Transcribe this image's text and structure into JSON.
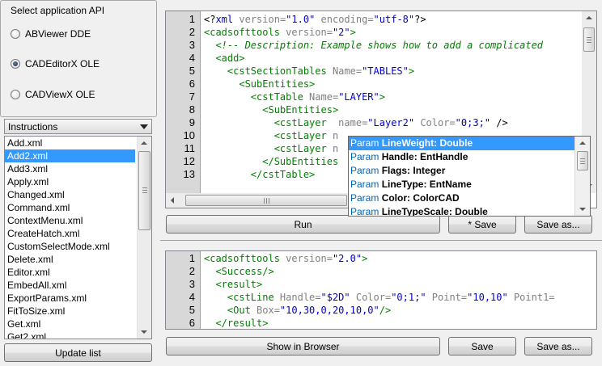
{
  "api_group": {
    "title": "Select application API",
    "options": [
      {
        "label": "ABViewer DDE",
        "checked": false
      },
      {
        "label": "CADEditorX OLE",
        "checked": true
      },
      {
        "label": "CADViewX OLE",
        "checked": false
      }
    ]
  },
  "instructions": {
    "selected": "Instructions",
    "files": [
      "Add.xml",
      "Add2.xml",
      "Add3.xml",
      "Apply.xml",
      "Changed.xml",
      "Command.xml",
      "ContextMenu.xml",
      "CreateHatch.xml",
      "CustomSelectMode.xml",
      "Delete.xml",
      "Editor.xml",
      "EmbedAll.xml",
      "ExportParams.xml",
      "FitToSize.xml",
      "Get.xml",
      "Get2.xml"
    ],
    "selected_file": "Add2.xml",
    "update_label": "Update list"
  },
  "top_editor": {
    "lines": [
      {
        "n": "1",
        "parts": [
          [
            "t-tx",
            "<?"
          ],
          [
            "t-pi",
            "xml"
          ],
          [
            "t-attr",
            " version="
          ],
          [
            "t-val",
            "\"1.0\""
          ],
          [
            "t-attr",
            " encoding="
          ],
          [
            "t-val",
            "\"utf-8\""
          ],
          [
            "t-tx",
            "?>"
          ]
        ]
      },
      {
        "n": "2",
        "parts": [
          [
            "t-tag",
            "<cadsofttools"
          ],
          [
            "t-attr",
            " version="
          ],
          [
            "t-val",
            "\"2\""
          ],
          [
            "t-tag",
            ">"
          ]
        ]
      },
      {
        "n": "3",
        "parts": [
          [
            "t-cmt",
            "  <!-- Description: Example shows how to add a complicated"
          ]
        ]
      },
      {
        "n": "4",
        "parts": [
          [
            "t-tag",
            "  <add>"
          ]
        ]
      },
      {
        "n": "5",
        "parts": [
          [
            "t-tag",
            "    <cstSectionTables"
          ],
          [
            "t-attr",
            " Name="
          ],
          [
            "t-val",
            "\"TABLES\""
          ],
          [
            "t-tag",
            ">"
          ]
        ]
      },
      {
        "n": "6",
        "parts": [
          [
            "t-tag",
            "      <SubEntities>"
          ]
        ]
      },
      {
        "n": "7",
        "parts": [
          [
            "t-tag",
            "        <cstTable"
          ],
          [
            "t-attr",
            " Name="
          ],
          [
            "t-val",
            "\"LAYER\""
          ],
          [
            "t-tag",
            ">"
          ]
        ]
      },
      {
        "n": "8",
        "parts": [
          [
            "t-tag",
            "          <SubEntities>"
          ]
        ]
      },
      {
        "n": "9",
        "parts": [
          [
            "t-tag",
            "            <cstLayer"
          ],
          [
            "t-attr",
            "  name="
          ],
          [
            "t-val",
            "\"Layer2\""
          ],
          [
            "t-attr",
            " Color="
          ],
          [
            "t-val",
            "\"0;3;\""
          ],
          [
            "t-tx",
            " />"
          ]
        ]
      },
      {
        "n": "10",
        "parts": [
          [
            "t-tag",
            "            <cstLayer"
          ],
          [
            "t-attr",
            " n"
          ]
        ]
      },
      {
        "n": "11",
        "parts": [
          [
            "t-tag",
            "            <cstLayer"
          ],
          [
            "t-attr",
            " n"
          ]
        ]
      },
      {
        "n": "12",
        "parts": [
          [
            "t-tag",
            "          </SubEntities"
          ]
        ]
      },
      {
        "n": "13",
        "parts": [
          [
            "t-tag",
            "        </cstTable>"
          ]
        ]
      }
    ],
    "run_label": "Run",
    "save_label": "* Save",
    "saveas_label": "Save as..."
  },
  "autocomplete": {
    "items": [
      {
        "kw": "Param",
        "name": "LineWeight: Double",
        "selected": true
      },
      {
        "kw": "Param",
        "name": "Handle: EntHandle",
        "selected": false
      },
      {
        "kw": "Param",
        "name": "Flags: Integer",
        "selected": false
      },
      {
        "kw": "Param",
        "name": "LineType: EntName",
        "selected": false
      },
      {
        "kw": "Param",
        "name": "Color: ColorCAD",
        "selected": false
      },
      {
        "kw": "Param",
        "name": "LineTypeScale: Double",
        "selected": false
      }
    ]
  },
  "bottom_editor": {
    "lines": [
      {
        "n": "1",
        "parts": [
          [
            "t-tag",
            "<cadsofttools"
          ],
          [
            "t-attr",
            " version="
          ],
          [
            "t-val",
            "\"2.0\""
          ],
          [
            "t-tag",
            ">"
          ]
        ]
      },
      {
        "n": "2",
        "parts": [
          [
            "t-tag",
            "  <Success/>"
          ]
        ]
      },
      {
        "n": "3",
        "parts": [
          [
            "t-tag",
            "  <result>"
          ]
        ]
      },
      {
        "n": "4",
        "parts": [
          [
            "t-tag",
            "    <cstLine"
          ],
          [
            "t-attr",
            " Handle="
          ],
          [
            "t-val",
            "\"$2D\""
          ],
          [
            "t-attr",
            " Color="
          ],
          [
            "t-val",
            "\"0;1;\""
          ],
          [
            "t-attr",
            " Point="
          ],
          [
            "t-val",
            "\"10,10\""
          ],
          [
            "t-attr",
            " Point1="
          ]
        ]
      },
      {
        "n": "5",
        "parts": [
          [
            "t-tag",
            "    <Out"
          ],
          [
            "t-attr",
            " Box="
          ],
          [
            "t-val",
            "\"10,30,0,20,10,0\""
          ],
          [
            "t-tag",
            "/>"
          ]
        ]
      },
      {
        "n": "6",
        "parts": [
          [
            "t-tag",
            "  </result>"
          ]
        ]
      }
    ],
    "browser_label": "Show in Browser",
    "save_label": "Save",
    "saveas_label": "Save as..."
  },
  "colors": {
    "selection": "#3399ff",
    "tag": "#008000",
    "value": "#0000cc",
    "attr": "#808080"
  }
}
